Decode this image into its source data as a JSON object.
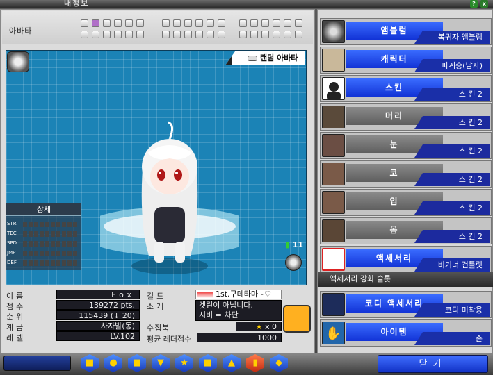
{
  "window": {
    "title": "내정보"
  },
  "avatar": {
    "label": "아바타",
    "random_avatar": "랜덤 아바타",
    "detail_title": "상세",
    "stat_names": [
      "STR",
      "TEC",
      "SPD",
      "JMP",
      "DEF"
    ],
    "signal": "11"
  },
  "profile": {
    "name_label": "이름",
    "name": "Fox",
    "score_label": "점수",
    "score": "139272 pts.",
    "rank_label": "순위",
    "rank": "115439 (↓ 20)",
    "class_label": "계급",
    "class": "사자발(동)",
    "level_label": "레벨",
    "level": "LV.102",
    "guild_label": "길드",
    "guild": "1st.구데타마~♡",
    "intro_label": "소개",
    "intro_line1": "겟린이 아닙니다.",
    "intro_line2": "시비 = 차단",
    "collection_label": "수집북",
    "collection": "x 0",
    "ladder_label": "평균 레더점수",
    "ladder": "1000"
  },
  "equipment": [
    {
      "name": "앰블럼",
      "value": "복귀자 앰블럼"
    },
    {
      "name": "캐릭터",
      "value": "파계승(남자)"
    },
    {
      "name": "스킨",
      "value": "스 킨 2"
    },
    {
      "name": "머리",
      "value": "스 킨 2"
    },
    {
      "name": "눈",
      "value": "스 킨 2"
    },
    {
      "name": "코",
      "value": "스 킨 2"
    },
    {
      "name": "입",
      "value": "스 킨 2"
    },
    {
      "name": "몸",
      "value": "스 킨 2"
    },
    {
      "name": "액세서리",
      "value": "비기너 건틀릿"
    }
  ],
  "accessory_slot_label": "액세서리 강화 슬롯",
  "extras": [
    {
      "name": "코디 액세서리",
      "value": "코디 미착용"
    },
    {
      "name": "아이템",
      "value": "손"
    }
  ],
  "close_label": "닫기"
}
